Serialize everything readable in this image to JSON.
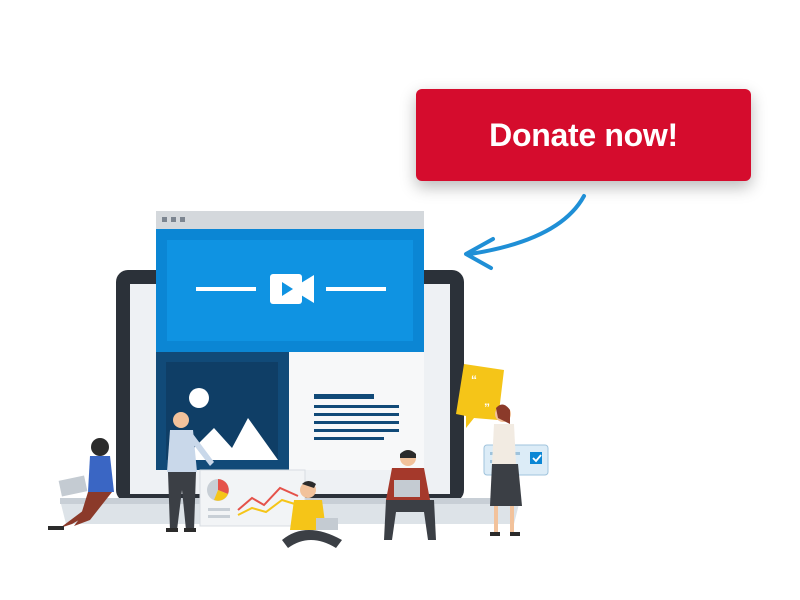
{
  "cta": {
    "label": "Donate now!",
    "color": "#d50c2d"
  },
  "illustration": {
    "video_icon": "video-camera-play-icon",
    "image_icon": "image-placeholder-icon",
    "quote_icon": "quote-bubble-icon",
    "check_icon": "checkbox-check-icon",
    "arrow_icon": "curved-arrow-icon",
    "colors": {
      "accent_blue": "#0b86d4",
      "dark_blue": "#114a78",
      "laptop_frame": "#2b3139",
      "yellow": "#f5c518",
      "red_shirt": "#a5392b"
    }
  }
}
